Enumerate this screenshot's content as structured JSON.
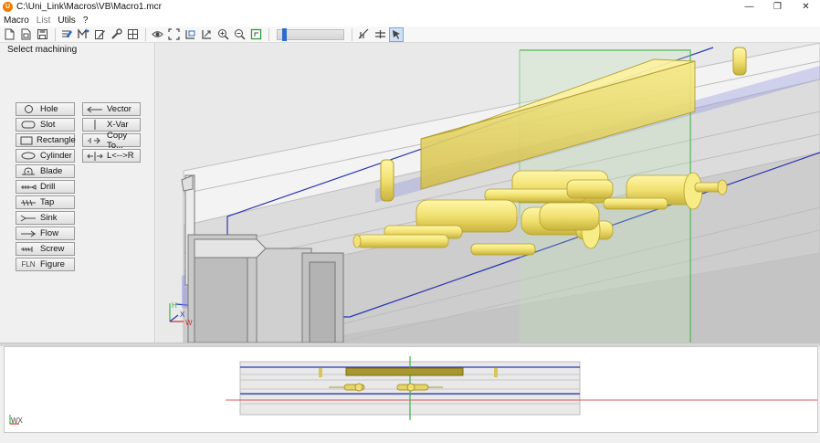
{
  "window": {
    "title": "C:\\Uni_Link\\Macros\\VB\\Macro1.mcr",
    "app_icon_letter": "U"
  },
  "window_controls": {
    "minimize": "—",
    "restore": "❐",
    "close": "✕"
  },
  "menu": [
    {
      "label": "Macro",
      "enabled": true
    },
    {
      "label": "List",
      "enabled": false
    },
    {
      "label": "Utils",
      "enabled": true
    },
    {
      "label": "?",
      "enabled": true
    }
  ],
  "panel": {
    "title": "Select machining"
  },
  "machining_left": [
    "Hole",
    "Slot",
    "Rectangle",
    "Cylinder",
    "Blade",
    "Drill",
    "Tap",
    "Sink",
    "Flow",
    "Screw",
    "Figure"
  ],
  "machining_right": [
    "Vector",
    "X-Var",
    "Copy To...",
    "L<-->R"
  ],
  "glyph_figure": "FLN",
  "toolbar": {
    "zoom_level": 0.08
  },
  "axes_3d": {
    "x": "X",
    "w": "W",
    "h": "H"
  },
  "axes_2d": {
    "label": "WX"
  }
}
